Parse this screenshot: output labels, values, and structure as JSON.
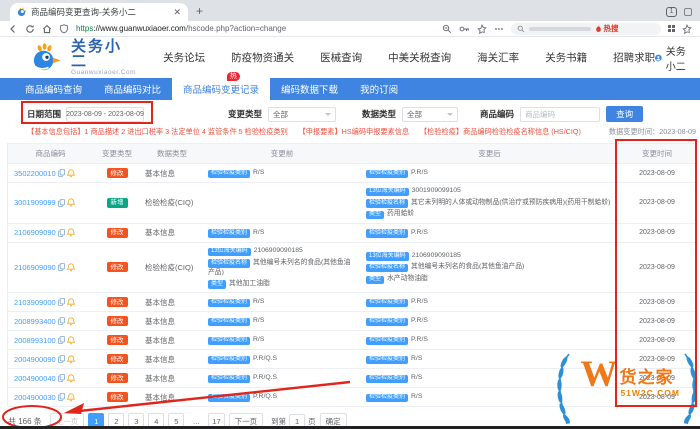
{
  "browser": {
    "tab_title": "商品编码变更查询-关务小二",
    "url_scheme": "https",
    "url_host": "://www.guanwuxiaoer.com",
    "url_path": "/hscode.php?action=change",
    "hot_search": "热搜",
    "window_badge": "1"
  },
  "header": {
    "logo_title": "关务小二",
    "logo_subtitle": "Guanwuxiaoer.Com",
    "nav": [
      "关务论坛",
      "防疫物资通关",
      "医械查询",
      "中美关税查询",
      "海关汇率",
      "关务书籍",
      "招聘求职"
    ],
    "user_name": "关务小二"
  },
  "tabs": {
    "hot_badge": "热",
    "items": [
      {
        "label": "商品编码查询",
        "active": false
      },
      {
        "label": "商品编码对比",
        "active": false
      },
      {
        "label": "商品编码变更记录",
        "active": true,
        "hot": true
      },
      {
        "label": "编码数据下载",
        "active": false
      },
      {
        "label": "我的订阅",
        "active": false
      }
    ]
  },
  "filters": {
    "date_label": "日期范围",
    "date_value": "2023-08-09 - 2023-08-09",
    "change_type_label": "变更类型",
    "change_type_value": "全部",
    "data_type_label": "数据类型",
    "data_type_value": "全部",
    "code_label": "商品编码",
    "code_placeholder": "商品编码",
    "search_button": "查询",
    "note": "【基本信息包括】1 商品描述 2 进出口税率 3 法定单位 4 监管条件 5 检验检疫类别　　【申报要素】HS编码申报要素信息　　【检验检疫】商品编码检验检疫名称信息 (HS/CIQ)",
    "update_time_label": "数据变更时间：",
    "update_time_value": "2023-08-09"
  },
  "table": {
    "headers": [
      "商品编码",
      "变更类型",
      "数据类型",
      "变更前",
      "变更后",
      "变更时间"
    ],
    "rows": [
      {
        "code": "3502200010",
        "change_type": "修改",
        "kind": "edit",
        "data_type": "基本信息",
        "before": [
          {
            "tag": "检验检疫类别",
            "text": "R/S"
          }
        ],
        "after": [
          {
            "tag": "检验检疫类别",
            "text": "P.R/S"
          }
        ],
        "time": "2023-08-09"
      },
      {
        "code": "3001909099",
        "change_type": "新增",
        "kind": "new",
        "data_type": "检验检疫(CIQ)",
        "before": [],
        "after": [
          {
            "tag": "13位海关编码",
            "text": "3001909099105"
          },
          {
            "tag": "检验检疫名称",
            "text": "其它未列明的人体或动物制品(供治疗或预防疾病用)(药用干制蛤蚧)"
          },
          {
            "tag": "类型",
            "text": "药用蛤蚧"
          }
        ],
        "time": "2023-08-09"
      },
      {
        "code": "2106909090",
        "change_type": "修改",
        "kind": "edit",
        "data_type": "基本信息",
        "before": [
          {
            "tag": "检验检疫类别",
            "text": "R/S"
          }
        ],
        "after": [
          {
            "tag": "检验检疫类别",
            "text": "P.R/S"
          }
        ],
        "time": "2023-08-09"
      },
      {
        "code": "2106909090",
        "change_type": "修改",
        "kind": "edit",
        "data_type": "检验检疫(CIQ)",
        "before": [
          {
            "tag": "13位海关编码",
            "text": "2106909090185"
          },
          {
            "tag": "检验检疫名称",
            "text": "其他编号未列名的食品(其他鱼油产品)"
          },
          {
            "tag": "类型",
            "text": "其他加工油脂"
          }
        ],
        "after": [
          {
            "tag": "13位海关编码",
            "text": "2106909090185"
          },
          {
            "tag": "检验检疫名称",
            "text": "其他编号未列名的食品(其他鱼油产品)"
          },
          {
            "tag": "类型",
            "text": "水产动物油脂"
          }
        ],
        "time": "2023-08-09"
      },
      {
        "code": "2103909000",
        "change_type": "修改",
        "kind": "edit",
        "data_type": "基本信息",
        "before": [
          {
            "tag": "检验检疫类别",
            "text": "R/S"
          }
        ],
        "after": [
          {
            "tag": "检验检疫类别",
            "text": "P.R/S"
          }
        ],
        "time": "2023-08-09"
      },
      {
        "code": "2008993400",
        "change_type": "修改",
        "kind": "edit",
        "data_type": "基本信息",
        "before": [
          {
            "tag": "检验检疫类别",
            "text": "R/S"
          }
        ],
        "after": [
          {
            "tag": "检验检疫类别",
            "text": "P.R/S"
          }
        ],
        "time": "2023-08-09"
      },
      {
        "code": "2008993100",
        "change_type": "修改",
        "kind": "edit",
        "data_type": "基本信息",
        "before": [
          {
            "tag": "检验检疫类别",
            "text": "R/S"
          }
        ],
        "after": [
          {
            "tag": "检验检疫类别",
            "text": "P.R/S"
          }
        ],
        "time": "2023-08-09"
      },
      {
        "code": "2004900090",
        "change_type": "修改",
        "kind": "edit",
        "data_type": "基本信息",
        "before": [
          {
            "tag": "检验检疫类别",
            "text": "P.R/Q.S"
          }
        ],
        "after": [
          {
            "tag": "检验检疫类别",
            "text": "R/S"
          }
        ],
        "time": "2023-08-09"
      },
      {
        "code": "2004900040",
        "change_type": "修改",
        "kind": "edit",
        "data_type": "基本信息",
        "before": [
          {
            "tag": "检验检疫类别",
            "text": "P.R/Q.S"
          }
        ],
        "after": [
          {
            "tag": "检验检疫类别",
            "text": "R/S"
          }
        ],
        "time": "2023-08-09"
      },
      {
        "code": "2004900030",
        "change_type": "修改",
        "kind": "edit",
        "data_type": "基本信息",
        "before": [
          {
            "tag": "检验检疫类别",
            "text": "P.R/Q.S"
          }
        ],
        "after": [
          {
            "tag": "检验检疫类别",
            "text": "R/S"
          }
        ],
        "time": "2023-08-09"
      }
    ]
  },
  "pagination": {
    "total": "共 166 条",
    "prev": "上一页",
    "pages": [
      "1",
      "2",
      "3",
      "4",
      "5",
      "...",
      "17"
    ],
    "active_page": "1",
    "next": "下一页",
    "jump_prefix": "到第",
    "jump_value": "1",
    "jump_suffix": "页",
    "confirm": "确定"
  },
  "watermark": {
    "letter": "W",
    "name": "货之家",
    "site": "51W2C.COM"
  },
  "colors": {
    "accent": "#3e84e0",
    "link": "#409eff",
    "badge_edit": "#f5531d",
    "badge_new": "#0aa786",
    "annotation": "#e1251b"
  }
}
